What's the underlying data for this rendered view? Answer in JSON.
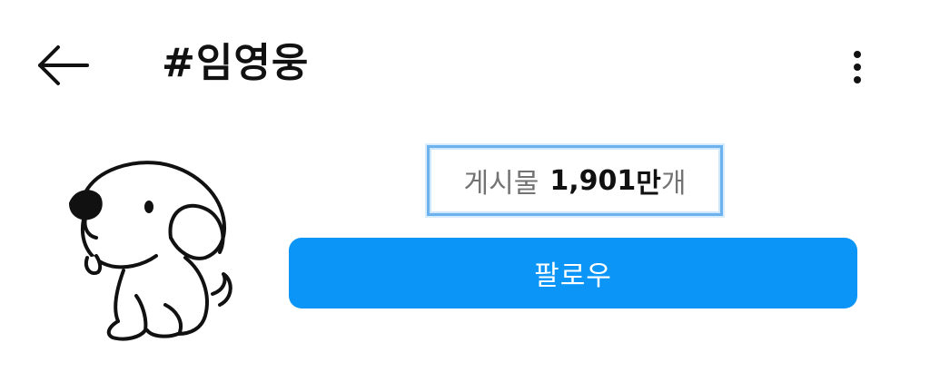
{
  "header": {
    "back_icon": "arrow-left-icon",
    "title": "#임영웅",
    "more_icon": "more-vertical-icon"
  },
  "profile": {
    "avatar_icon": "puppy-drawing",
    "posts": {
      "label": "게시물",
      "count": "1,901",
      "unit_strong": "만",
      "unit": "개"
    },
    "follow_label": "팔로우"
  },
  "colors": {
    "follow_button": "#0b95f6",
    "follow_text": "#ffffff",
    "muted_text": "#737373",
    "highlight_border": "#6cb2ef"
  }
}
